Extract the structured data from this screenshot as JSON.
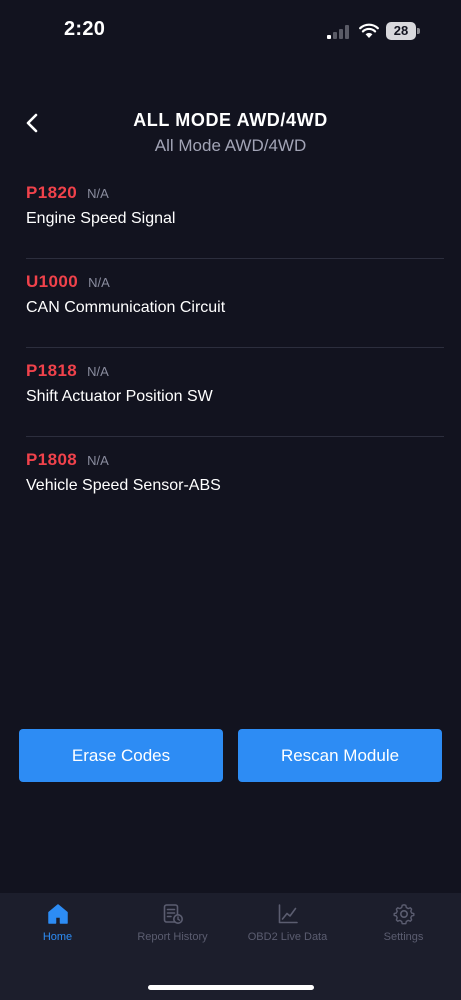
{
  "status_bar": {
    "time": "2:20",
    "battery": "28"
  },
  "header": {
    "title": "ALL MODE AWD/4WD",
    "subtitle": "All Mode AWD/4WD"
  },
  "codes": [
    {
      "code": "P1820",
      "status": "N/A",
      "description": "Engine Speed Signal"
    },
    {
      "code": "U1000",
      "status": "N/A",
      "description": "CAN Communication Circuit"
    },
    {
      "code": "P1818",
      "status": "N/A",
      "description": "Shift Actuator Position SW"
    },
    {
      "code": "P1808",
      "status": "N/A",
      "description": "Vehicle Speed Sensor-ABS"
    }
  ],
  "actions": {
    "erase_label": "Erase Codes",
    "rescan_label": "Rescan Module"
  },
  "tabs": [
    {
      "label": "Home",
      "icon": "home-icon",
      "active": true
    },
    {
      "label": "Report History",
      "icon": "report-icon",
      "active": false
    },
    {
      "label": "OBD2 Live Data",
      "icon": "chart-icon",
      "active": false
    },
    {
      "label": "Settings",
      "icon": "gear-icon",
      "active": false
    }
  ],
  "colors": {
    "background": "#12131f",
    "accent": "#2d8cf4",
    "code_red": "#f0424b",
    "tab_bar": "#1c1e2c"
  }
}
